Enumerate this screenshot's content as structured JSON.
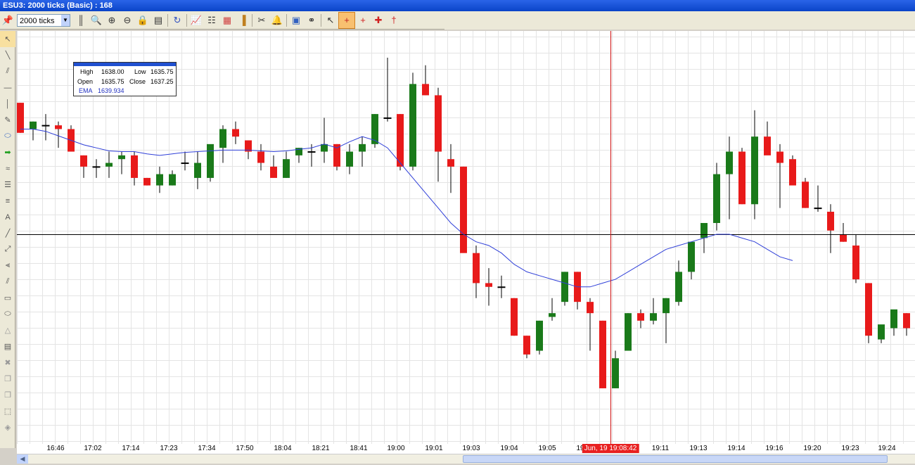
{
  "window": {
    "title": "ESU3: 2000 ticks (Basic) : 168"
  },
  "toolbar": {
    "timeframe": "2000 ticks",
    "icons": [
      "pin-icon",
      "timeframe-dropdown",
      "bar-style-icon",
      "zoom-icon",
      "zoom-in-icon",
      "zoom-out-icon",
      "lock-icon",
      "properties-icon",
      "refresh-icon",
      "indicators-icon",
      "strategy-icon",
      "data-box-icon",
      "volume-icon",
      "drawing-icon",
      "alert-icon",
      "chart-trader-icon",
      "link-icon",
      "pointer-icon",
      "crosshair-icon",
      "global-crosshair-icon",
      "crosshair-star-icon",
      "move-icon"
    ]
  },
  "left_tools": [
    "pointer-icon",
    "line-icon",
    "ray-icon",
    "hline-icon",
    "vline-icon",
    "text-icon",
    "ellipse-icon",
    "arrow-icon",
    "channel-icon",
    "fib-icon",
    "fib-ext-icon",
    "text-a-icon",
    "pitchfork-icon",
    "gann-icon",
    "fan-icon",
    "regression-icon",
    "rectangle-icon",
    "circle-icon",
    "triangle-icon",
    "calendar-icon",
    "delete-icon",
    "copy-icon",
    "paste-icon",
    "select-icon",
    "hide-icon"
  ],
  "databox": {
    "high_label": "High",
    "high": "1638.00",
    "low_label": "Low",
    "low": "1635.75",
    "open_label": "Open",
    "open": "1635.75",
    "close_label": "Close",
    "close": "1637.25",
    "ema_label": "EMA",
    "ema": "1639.934"
  },
  "xaxis": {
    "labels": [
      "16:46",
      "17:02",
      "17:14",
      "17:23",
      "17:34",
      "17:50",
      "18:04",
      "18:21",
      "18:41",
      "19:00",
      "19:01",
      "19:03",
      "19:04",
      "19:05",
      "19:06",
      "19:11",
      "19:13",
      "19:14",
      "19:16",
      "19:20",
      "19:23",
      "19:24"
    ],
    "cursor_time": "Jun, 19 19:08:42"
  },
  "colors": {
    "up": "#1a7a1a",
    "down": "#e81a1a",
    "ema": "#2f3fd8",
    "crosshair": "#d01010",
    "hline": "#000000"
  },
  "chart_data": {
    "type": "candlestick",
    "symbol": "ESU3",
    "bars": [
      {
        "o": 1644.0,
        "h": 1644.0,
        "l": 1642.0,
        "c": 1642.0
      },
      {
        "o": 1642.25,
        "h": 1642.75,
        "l": 1641.5,
        "c": 1642.75
      },
      {
        "o": 1642.5,
        "h": 1643.25,
        "l": 1641.5,
        "c": 1642.5
      },
      {
        "o": 1642.5,
        "h": 1642.75,
        "l": 1641.0,
        "c": 1642.25
      },
      {
        "o": 1642.25,
        "h": 1642.5,
        "l": 1641.0,
        "c": 1640.75
      },
      {
        "o": 1640.5,
        "h": 1640.5,
        "l": 1639.0,
        "c": 1639.75
      },
      {
        "o": 1639.75,
        "h": 1640.25,
        "l": 1639.0,
        "c": 1639.75
      },
      {
        "o": 1639.75,
        "h": 1640.75,
        "l": 1639.0,
        "c": 1640.0
      },
      {
        "o": 1640.25,
        "h": 1640.75,
        "l": 1639.25,
        "c": 1640.5
      },
      {
        "o": 1640.5,
        "h": 1640.75,
        "l": 1638.5,
        "c": 1639.0
      },
      {
        "o": 1639.0,
        "h": 1639.0,
        "l": 1638.5,
        "c": 1638.5
      },
      {
        "o": 1638.5,
        "h": 1639.75,
        "l": 1638.0,
        "c": 1639.25
      },
      {
        "o": 1638.5,
        "h": 1639.5,
        "l": 1638.5,
        "c": 1639.25
      },
      {
        "o": 1640.0,
        "h": 1640.75,
        "l": 1639.5,
        "c": 1640.0
      },
      {
        "o": 1639.0,
        "h": 1640.75,
        "l": 1638.25,
        "c": 1640.0
      },
      {
        "o": 1639.0,
        "h": 1641.0,
        "l": 1638.75,
        "c": 1641.25
      },
      {
        "o": 1641.0,
        "h": 1642.5,
        "l": 1640.0,
        "c": 1642.25
      },
      {
        "o": 1642.25,
        "h": 1642.75,
        "l": 1641.25,
        "c": 1641.75
      },
      {
        "o": 1641.5,
        "h": 1641.5,
        "l": 1640.25,
        "c": 1640.75
      },
      {
        "o": 1640.75,
        "h": 1641.25,
        "l": 1639.5,
        "c": 1640.0
      },
      {
        "o": 1639.75,
        "h": 1640.5,
        "l": 1639.25,
        "c": 1639.0
      },
      {
        "o": 1639.0,
        "h": 1640.75,
        "l": 1639.0,
        "c": 1640.25
      },
      {
        "o": 1640.5,
        "h": 1641.0,
        "l": 1640.0,
        "c": 1641.0
      },
      {
        "o": 1640.75,
        "h": 1641.25,
        "l": 1639.75,
        "c": 1640.75
      },
      {
        "o": 1640.75,
        "h": 1643.0,
        "l": 1640.0,
        "c": 1641.25
      },
      {
        "o": 1641.25,
        "h": 1641.25,
        "l": 1639.5,
        "c": 1639.75
      },
      {
        "o": 1639.75,
        "h": 1641.25,
        "l": 1639.25,
        "c": 1640.75
      },
      {
        "o": 1640.75,
        "h": 1641.75,
        "l": 1639.75,
        "c": 1641.25
      },
      {
        "o": 1641.25,
        "h": 1643.25,
        "l": 1641.0,
        "c": 1643.25
      },
      {
        "o": 1643.0,
        "h": 1647.0,
        "l": 1642.75,
        "c": 1643.0
      },
      {
        "o": 1643.25,
        "h": 1643.25,
        "l": 1639.5,
        "c": 1639.75
      },
      {
        "o": 1639.75,
        "h": 1646.0,
        "l": 1639.5,
        "c": 1645.25
      },
      {
        "o": 1645.25,
        "h": 1646.5,
        "l": 1644.5,
        "c": 1644.5
      },
      {
        "o": 1644.5,
        "h": 1645.0,
        "l": 1638.75,
        "c": 1640.75
      },
      {
        "o": 1640.25,
        "h": 1641.25,
        "l": 1638.0,
        "c": 1639.75
      },
      {
        "o": 1639.75,
        "h": 1639.75,
        "l": 1636.25,
        "c": 1634.0
      },
      {
        "o": 1634.0,
        "h": 1634.5,
        "l": 1631.0,
        "c": 1632.0
      },
      {
        "o": 1632.0,
        "h": 1633.0,
        "l": 1630.5,
        "c": 1631.75
      },
      {
        "o": 1631.75,
        "h": 1632.5,
        "l": 1631.0,
        "c": 1631.75
      },
      {
        "o": 1631.0,
        "h": 1631.0,
        "l": 1628.5,
        "c": 1628.5
      },
      {
        "o": 1628.5,
        "h": 1628.5,
        "l": 1627.0,
        "c": 1627.25
      },
      {
        "o": 1627.5,
        "h": 1629.5,
        "l": 1627.25,
        "c": 1629.5
      },
      {
        "o": 1629.75,
        "h": 1631.0,
        "l": 1629.5,
        "c": 1630.0
      },
      {
        "o": 1630.75,
        "h": 1632.75,
        "l": 1630.5,
        "c": 1632.75
      },
      {
        "o": 1632.75,
        "h": 1632.75,
        "l": 1630.25,
        "c": 1630.75
      },
      {
        "o": 1630.75,
        "h": 1631.0,
        "l": 1627.5,
        "c": 1630.0
      },
      {
        "o": 1629.5,
        "h": 1629.5,
        "l": 1625.0,
        "c": 1625.0
      },
      {
        "o": 1625.0,
        "h": 1627.5,
        "l": 1625.0,
        "c": 1627.0
      },
      {
        "o": 1627.5,
        "h": 1630.0,
        "l": 1627.5,
        "c": 1630.0
      },
      {
        "o": 1630.0,
        "h": 1630.25,
        "l": 1629.0,
        "c": 1629.5
      },
      {
        "o": 1629.5,
        "h": 1631.0,
        "l": 1629.25,
        "c": 1630.0
      },
      {
        "o": 1630.0,
        "h": 1631.0,
        "l": 1628.0,
        "c": 1631.0
      },
      {
        "o": 1630.75,
        "h": 1633.5,
        "l": 1630.5,
        "c": 1632.75
      },
      {
        "o": 1632.75,
        "h": 1634.75,
        "l": 1632.25,
        "c": 1634.75
      },
      {
        "o": 1635.0,
        "h": 1635.75,
        "l": 1634.0,
        "c": 1636.0
      },
      {
        "o": 1636.0,
        "h": 1640.0,
        "l": 1635.5,
        "c": 1639.25
      },
      {
        "o": 1639.25,
        "h": 1641.75,
        "l": 1636.25,
        "c": 1640.75
      },
      {
        "o": 1640.75,
        "h": 1641.0,
        "l": 1637.25,
        "c": 1637.25
      },
      {
        "o": 1637.25,
        "h": 1643.5,
        "l": 1636.25,
        "c": 1641.75
      },
      {
        "o": 1641.75,
        "h": 1642.75,
        "l": 1640.75,
        "c": 1640.5
      },
      {
        "o": 1640.75,
        "h": 1641.25,
        "l": 1637.0,
        "c": 1640.0
      },
      {
        "o": 1640.25,
        "h": 1640.5,
        "l": 1639.0,
        "c": 1638.5
      },
      {
        "o": 1638.75,
        "h": 1639.0,
        "l": 1637.0,
        "c": 1637.0
      },
      {
        "o": 1637.0,
        "h": 1638.5,
        "l": 1636.75,
        "c": 1637.0
      },
      {
        "o": 1636.75,
        "h": 1637.25,
        "l": 1634.0,
        "c": 1635.5
      },
      {
        "o": 1635.25,
        "h": 1636.0,
        "l": 1634.75,
        "c": 1634.75
      },
      {
        "o": 1634.5,
        "h": 1635.25,
        "l": 1632.0,
        "c": 1632.25
      },
      {
        "o": 1632.0,
        "h": 1632.0,
        "l": 1628.0,
        "c": 1628.5
      },
      {
        "o": 1628.25,
        "h": 1629.0,
        "l": 1628.0,
        "c": 1629.25
      },
      {
        "o": 1629.0,
        "h": 1630.0,
        "l": 1628.5,
        "c": 1630.25
      },
      {
        "o": 1630.0,
        "h": 1630.0,
        "l": 1628.5,
        "c": 1629.0
      },
      {
        "o": 1628.75,
        "h": 1630.5,
        "l": 1628.0,
        "c": 1632.5
      }
    ],
    "ema": [
      1642.25,
      1642.25,
      1642.1,
      1641.8,
      1641.5,
      1641.2,
      1641.0,
      1640.8,
      1640.75,
      1640.75,
      1640.6,
      1640.5,
      1640.6,
      1640.7,
      1640.75,
      1640.8,
      1640.85,
      1640.85,
      1640.85,
      1640.8,
      1640.75,
      1640.8,
      1640.9,
      1641.0,
      1641.25,
      1641.0,
      1641.4,
      1641.75,
      1641.5,
      1641.0,
      1640.0,
      1639.0,
      1638.0,
      1637.0,
      1636.0,
      1635.25,
      1634.75,
      1634.5,
      1634.0,
      1633.25,
      1632.75,
      1632.5,
      1632.25,
      1632.0,
      1631.75,
      1631.75,
      1632.0,
      1632.25,
      1632.75,
      1633.25,
      1633.75,
      1634.25,
      1634.5,
      1634.75,
      1635.0,
      1635.25,
      1635.25,
      1635.0,
      1634.75,
      1634.25,
      1633.75,
      1633.5
    ],
    "cursor_price": 1635.25
  }
}
